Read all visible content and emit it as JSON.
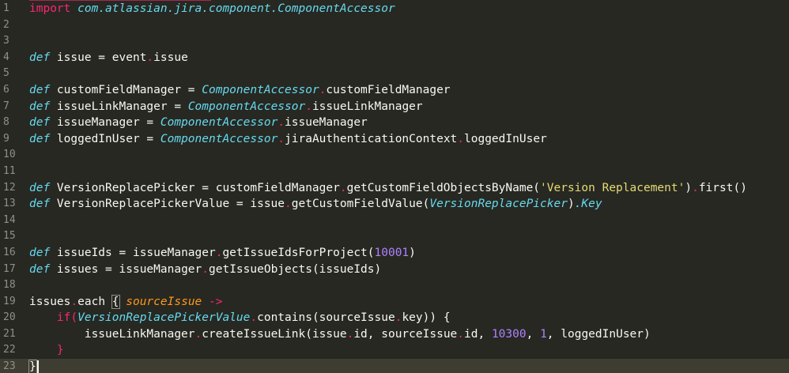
{
  "editor": {
    "theme_colors": {
      "background": "#272822",
      "keyword": "#f92672",
      "definition": "#66d9ef",
      "string": "#e6db74",
      "number": "#ae81ff",
      "parameter": "#fd971f",
      "line_number": "#8f908a",
      "current_line": "#3e3d32"
    },
    "current_line_number": 23,
    "line_numbers": [
      "1",
      "2",
      "3",
      "4",
      "5",
      "6",
      "7",
      "8",
      "9",
      "10",
      "11",
      "12",
      "13",
      "14",
      "15",
      "16",
      "17",
      "18",
      "19",
      "20",
      "21",
      "22",
      "23"
    ],
    "tokens": {
      "l1_import": "import",
      "l1_pkg": "com.atlassian.jira.component.ComponentAccessor",
      "def": "def",
      "l4_rest_a": " issue = event",
      "dot": ".",
      "l4_rest_b": "issue",
      "l6_name": " customFieldManager = ",
      "ca": "ComponentAccessor",
      "l6_prop": "customFieldManager",
      "l7_name": " issueLinkManager = ",
      "l7_prop": "issueLinkManager",
      "l8_name": " issueManager = ",
      "l8_prop": "issueManager",
      "l9_name": " loggedInUser = ",
      "l9_prop_a": "jiraAuthenticationContext",
      "l9_prop_b": "loggedInUser",
      "l12_name": " VersionReplacePicker = customFieldManager",
      "l12_method": "getCustomFieldObjectsByName(",
      "l12_string": "'Version Replacement'",
      "l12_close": ")",
      "l12_first": "first()",
      "l13_name": " VersionReplacePickerValue = issue",
      "l13_method": "getCustomFieldValue(",
      "l13_arg": "VersionReplacePicker",
      "l13_close": ")",
      "l13_key": ".Key",
      "l16_name": " issueIds = issueManager",
      "l16_method": "getIssueIdsForProject(",
      "l16_num": "10001",
      "l16_close": ")",
      "l17_name": " issues = issueManager",
      "l17_method": "getIssueObjects(issueIds)",
      "l19_a": "issues",
      "l19_b": "each ",
      "l19_brace": "{",
      "l19_param": " sourceIssue ",
      "l19_arrow": "->",
      "l20_indent": "    ",
      "l20_if": "if(",
      "l20_var": "VersionReplacePickerValue",
      "l20_method": "contains(sourceIssue",
      "l20_key": "key)) {",
      "l21_indent": "        ",
      "l21_call": "issueLinkManager",
      "l21_method": "createIssueLink(issue",
      "l21_id": "id, sourceIssue",
      "l21_id2": "id, ",
      "l21_num1": "10300",
      "l21_comma": ", ",
      "l21_num2": "1",
      "l21_end": ", loggedInUser)",
      "l22_indent": "    ",
      "l22_brace": "}",
      "l23_brace": "}"
    }
  }
}
